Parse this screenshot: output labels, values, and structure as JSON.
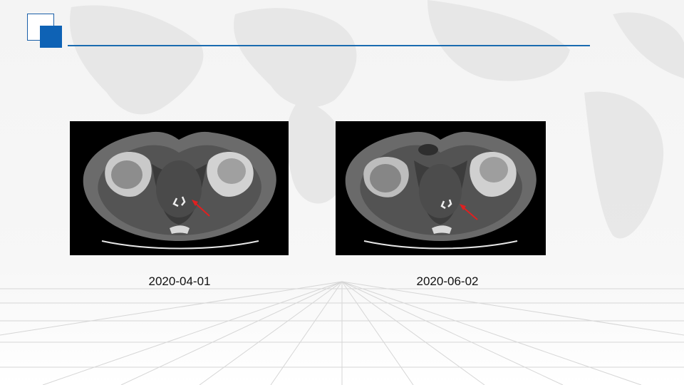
{
  "slide": {
    "images": [
      {
        "caption": "2020-04-01",
        "icon": "ct-scan-pelvis-icon",
        "annotation": "red-arrow-icon"
      },
      {
        "caption": "2020-06-02",
        "icon": "ct-scan-pelvis-icon",
        "annotation": "red-arrow-icon"
      }
    ]
  },
  "colors": {
    "accent": "#0e62b5",
    "arrow": "#e02020",
    "panel": "#000000"
  }
}
